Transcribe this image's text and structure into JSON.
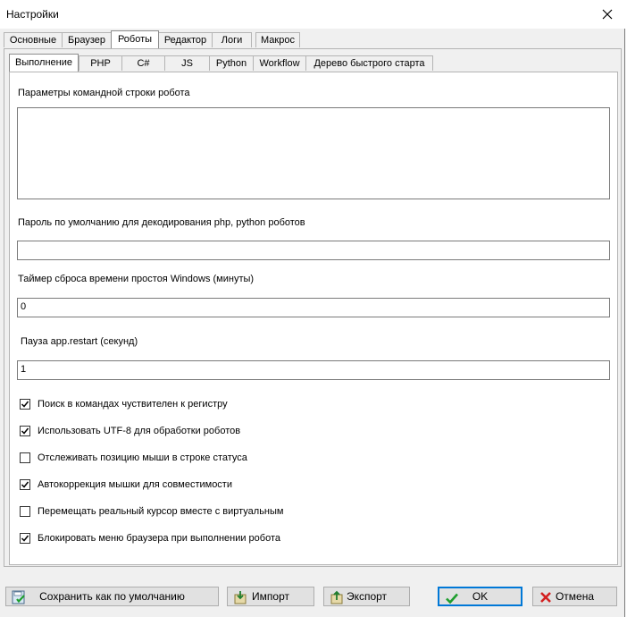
{
  "window": {
    "title": "Настройки"
  },
  "outer_tabs": [
    {
      "label": "Основные"
    },
    {
      "label": "Браузер"
    },
    {
      "label": "Роботы",
      "active": true
    },
    {
      "label": "Редактор"
    },
    {
      "label": "Логи"
    },
    {
      "label": "Макрос"
    }
  ],
  "inner_tabs": [
    {
      "label": "Выполнение",
      "active": true
    },
    {
      "label": "PHP"
    },
    {
      "label": "C#"
    },
    {
      "label": "JS"
    },
    {
      "label": "Python"
    },
    {
      "label": "Workflow"
    },
    {
      "label": "Дерево быстрого старта"
    }
  ],
  "form": {
    "cmd_params_label": "Параметры командной строки робота",
    "cmd_params_value": "",
    "password_label": "Пароль по умолчанию для декодирования php, python роботов",
    "password_value": "",
    "idle_timer_label": "Таймер сброса времени простоя Windows (минуты)",
    "idle_timer_value": "0",
    "pause_label": "Пауза app.restart (секунд)",
    "pause_value": "1"
  },
  "checkboxes": [
    {
      "label": "Поиск в командах чуствителен к регистру",
      "checked": true
    },
    {
      "label": "Использовать UTF-8 для обработки роботов",
      "checked": true
    },
    {
      "label": "Отслеживать позицию мыши в строке статуса",
      "checked": false
    },
    {
      "label": "Автокоррекция мышки для совместимости",
      "checked": true
    },
    {
      "label": "Перемещать реальный курсор вместе с виртуальным",
      "checked": false
    },
    {
      "label": "Блокировать меню браузера при выполнении робота",
      "checked": true
    }
  ],
  "buttons": {
    "save_default": "Сохранить как по умолчанию",
    "import": "Импорт",
    "export": "Экспорт",
    "ok": "OK",
    "cancel": "Отмена"
  },
  "icons": {
    "close": "close-icon",
    "save": "save-default-icon",
    "import": "import-icon",
    "export": "export-icon",
    "ok": "checkmark-icon",
    "cancel": "cancel-x-icon"
  }
}
